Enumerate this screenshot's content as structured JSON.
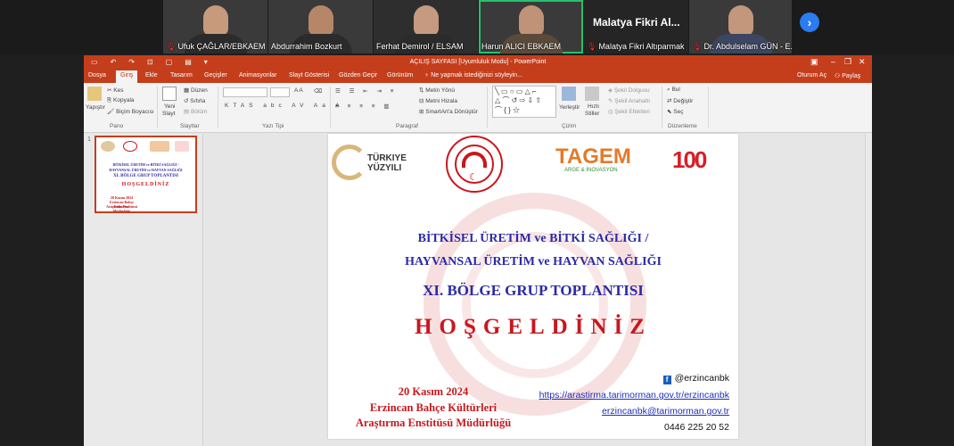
{
  "participants": [
    {
      "name": "Ufuk ÇAĞLAR/EBKAEM",
      "muted": true
    },
    {
      "name": "Abdurrahim Bozkurt",
      "muted": false
    },
    {
      "name": "Ferhat Demirol / ELSAM",
      "muted": false
    },
    {
      "name": "Harun ALICI EBKAEM",
      "muted": false,
      "active": true
    },
    {
      "name": "Malatya Fikri Altıparmak",
      "muted": true,
      "display_name": "Malatya Fikri Al..."
    },
    {
      "name": "Dr. Abdulselam GÜN - E...",
      "muted": true
    }
  ],
  "next_icon": "chevron-right-icon",
  "ppt": {
    "window_title": "AÇILIŞ SAYFASI [Uyumluluk Modu] - PowerPoint",
    "tabs": [
      "Dosya",
      "Giriş",
      "Ekle",
      "Tasarım",
      "Geçişler",
      "Animasyonlar",
      "Slayt Gösterisi",
      "Gözden Geçir",
      "Görünüm"
    ],
    "selected_tab": "Giriş",
    "tell_me": "Ne yapmak istediğinizi söyleyin...",
    "sign_in": "Oturum Aç",
    "share": "Paylaş",
    "ribbon": {
      "pano": "Pano",
      "paste": "Yapıştır",
      "cut": "Kes",
      "copy": "Kopyala",
      "format_painter": "Biçim Boyacısı",
      "slaytlar": "Slaytlar",
      "new_slide_1": "Yeni",
      "new_slide_2": "Slayt",
      "layout": "Düzen",
      "reset": "Sıfırla",
      "section": "Bölüm",
      "yazi_tipi": "Yazı Tipi",
      "paragraf": "Paragraf",
      "text_direction": "Metin Yönü",
      "align_text": "Metni Hizala",
      "smartart": "SmartArt'a Dönüştür",
      "cizim": "Çizim",
      "arrange": "Yerleştir",
      "quick_styles_1": "Hızlı",
      "quick_styles_2": "Stiller",
      "shape_fill": "Şekil Dolgusu",
      "shape_outline": "Şekil Anahattı",
      "shape_effects": "Şekil Efektleri",
      "duzenleme": "Düzenleme",
      "find": "Bul",
      "replace": "Değiştir",
      "select": "Seç"
    },
    "thumbnail_number": "1"
  },
  "slide": {
    "logos": [
      "TÜRKIYE YÜZYILI",
      "TAGEM",
      "ARGE & İNOVASYON",
      "100"
    ],
    "title_line1": "BİTKİSEL ÜRETİM ve BİTKİ SAĞLIĞI /",
    "title_line2": "HAYVANSAL ÜRETİM ve HAYVAN SAĞLIĞI",
    "title_line3": "XI. BÖLGE GRUP TOPLANTISI",
    "welcome": "HOŞGELDİNİZ",
    "date": "20 Kasım 2024",
    "institute_line1": "Erzincan Bahçe Kültürleri",
    "institute_line2": "Araştırma Enstitüsü Müdürlüğü",
    "social": "@erzincanbk",
    "website": "https://arastirma.tarimorman.gov.tr/erzincanbk",
    "email": "erzincanbk@tarimorman.gov.tr",
    "phone": "0446 225 20 52"
  },
  "colors": {
    "ppt_accent": "#c43e1c",
    "title_blue": "#2b2aa6",
    "welcome_red": "#c8171e",
    "active_speaker": "#24c26b"
  }
}
